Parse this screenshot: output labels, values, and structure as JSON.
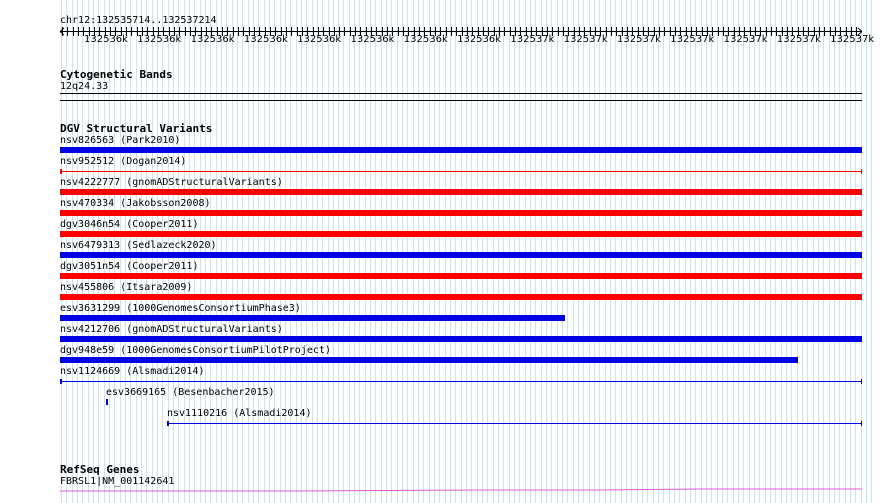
{
  "ruler": {
    "location": "chr12:132535714..132537214",
    "ticks": [
      "132536k",
      "132536k",
      "132536k",
      "132536k",
      "132536k",
      "132536k",
      "132536k",
      "132536k",
      "132537k",
      "132537k",
      "132537k",
      "132537k",
      "132537k",
      "132537k",
      "132537k"
    ]
  },
  "cytoband": {
    "title": "Cytogenetic Bands",
    "band": "12q24.33"
  },
  "dgv": {
    "title": "DGV Structural Variants",
    "variants": [
      {
        "label": "nsv826563 (Park2010)",
        "color": "#0000e6",
        "style": "bar",
        "start": 0.0,
        "end": 1.0
      },
      {
        "label": "nsv952512 (Dogan2014)",
        "color": "#ff0000",
        "style": "line",
        "start": 0.0,
        "end": 1.0
      },
      {
        "label": "nsv4222777 (gnomADStructuralVariants)",
        "color": "#ff0000",
        "style": "bar",
        "start": 0.0,
        "end": 1.0
      },
      {
        "label": "nsv470334 (Jakobsson2008)",
        "color": "#ff0000",
        "style": "bar",
        "start": 0.0,
        "end": 1.0
      },
      {
        "label": "dgv3046n54 (Cooper2011)",
        "color": "#ff0000",
        "style": "bar",
        "start": 0.0,
        "end": 1.0
      },
      {
        "label": "nsv6479313 (Sedlazeck2020)",
        "color": "#0000e6",
        "style": "bar",
        "start": 0.0,
        "end": 1.0
      },
      {
        "label": "dgv3051n54 (Cooper2011)",
        "color": "#ff0000",
        "style": "bar",
        "start": 0.0,
        "end": 1.0
      },
      {
        "label": "nsv455806 (Itsara2009)",
        "color": "#ff0000",
        "style": "bar",
        "start": 0.0,
        "end": 1.0
      },
      {
        "label": "esv3631299 (1000GenomesConsortiumPhase3)",
        "color": "#0000e6",
        "style": "bar",
        "start": 0.0,
        "end": 0.63
      },
      {
        "label": "nsv4212706 (gnomADStructuralVariants)",
        "color": "#0000e6",
        "style": "bar",
        "start": 0.0,
        "end": 1.0
      },
      {
        "label": "dgv948e59 (1000GenomesConsortiumPilotProject)",
        "color": "#0000e6",
        "style": "bar",
        "start": 0.0,
        "end": 0.92
      },
      {
        "label": "nsv1124669 (Alsmadi2014)",
        "color": "#0000e6",
        "style": "line",
        "start": 0.0,
        "end": 1.0
      },
      {
        "label": "esv3669165 (Besenbacher2015)",
        "color": "#0000e6",
        "style": "tick",
        "start": 0.057,
        "end": 0.06
      },
      {
        "label": "nsv1110216 (Alsmadi2014)",
        "color": "#0000e6",
        "style": "line",
        "start": 0.134,
        "end": 1.0
      }
    ]
  },
  "refseq": {
    "title": "RefSeq Genes",
    "gene": "FBRSL1|NM_001142641",
    "color": "#e05adc"
  }
}
